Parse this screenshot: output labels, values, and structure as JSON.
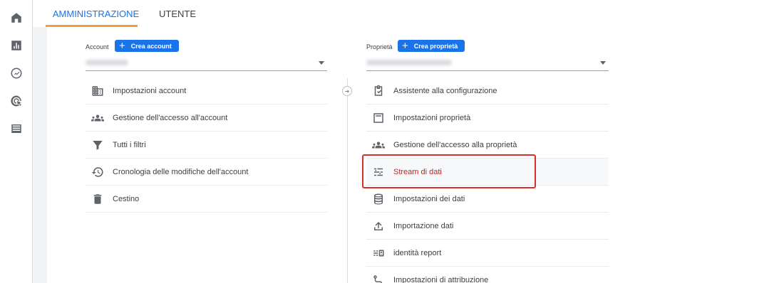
{
  "rail": {
    "icons": [
      "home-icon",
      "reports-icon",
      "explore-icon",
      "advertising-icon",
      "configure-icon"
    ]
  },
  "tabs": [
    {
      "label": "AMMINISTRAZIONE",
      "active": true
    },
    {
      "label": "UTENTE",
      "active": false
    }
  ],
  "account": {
    "header_label": "Account",
    "create_label": "Crea account",
    "items": [
      {
        "label": "Impostazioni account",
        "icon": "building-icon"
      },
      {
        "label": "Gestione dell'accesso all'account",
        "icon": "people-icon"
      },
      {
        "label": "Tutti i filtri",
        "icon": "filter-icon"
      },
      {
        "label": "Cronologia delle modifiche dell'account",
        "icon": "history-icon"
      },
      {
        "label": "Cestino",
        "icon": "trash-icon"
      }
    ]
  },
  "property": {
    "header_label": "Proprietà",
    "create_label": "Crea proprietà",
    "items": [
      {
        "label": "Assistente alla configurazione",
        "icon": "checklist-icon"
      },
      {
        "label": "Impostazioni proprietà",
        "icon": "layout-icon"
      },
      {
        "label": "Gestione dell'accesso alla proprietà",
        "icon": "people-icon"
      },
      {
        "label": "Stream di dati",
        "icon": "stream-icon",
        "selected": true
      },
      {
        "label": "Impostazioni dei dati",
        "icon": "database-icon"
      },
      {
        "label": "Importazione dati",
        "icon": "upload-icon"
      },
      {
        "label": "identità report",
        "icon": "report-identity-icon"
      },
      {
        "label": "Impostazioni di attribuzione",
        "icon": "attribution-icon"
      }
    ]
  },
  "colors": {
    "accent": "#1a73e8",
    "highlight": "#d93025",
    "selected_text": "#c5221f",
    "tab_underline": "#e8a33d"
  }
}
